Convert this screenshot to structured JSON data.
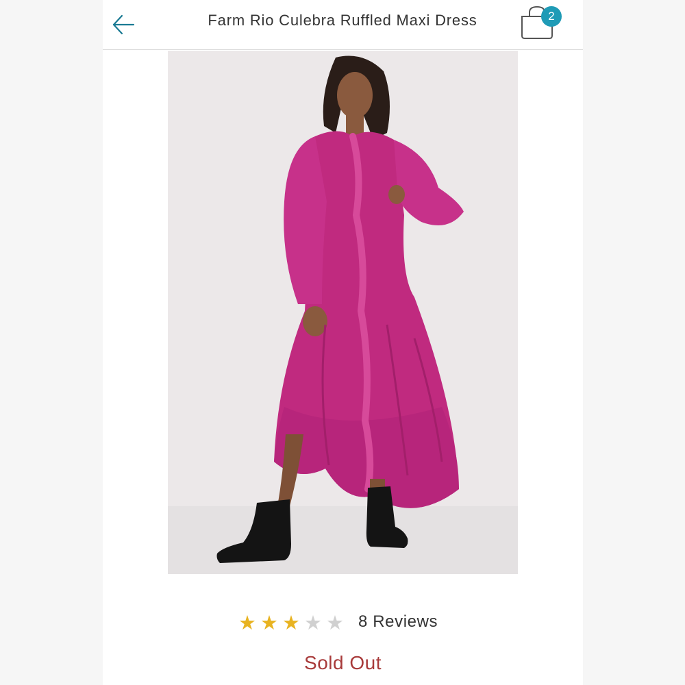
{
  "header": {
    "title": "Farm Rio Culebra Ruffled Maxi Dress",
    "back_icon": "arrow-left-icon",
    "cart_icon": "shopping-bag-icon",
    "cart_count": "2"
  },
  "product": {
    "image_alt": "Model wearing magenta ruffled maxi dress with black lace-up boots",
    "rating": 3,
    "rating_max": 5,
    "reviews_label": "8 Reviews",
    "status": "Sold Out"
  },
  "colors": {
    "accent": "#1f9bb6",
    "back_arrow": "#1a7a93",
    "star_filled": "#e8b321",
    "star_empty": "#d0d0d0",
    "sold_out": "#a83a3a",
    "dress": "#c02a7f"
  }
}
